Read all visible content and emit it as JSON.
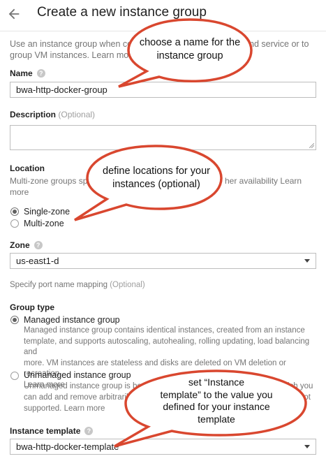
{
  "header": {
    "title": "Create a new instance group",
    "back_icon": "back-arrow-icon"
  },
  "intro": {
    "line1": "Use an instance group when co",
    "line1_tail": "nd service or to",
    "line2": "group VM instances. Learn mor"
  },
  "name": {
    "label": "Name",
    "value": "bwa-http-docker-group"
  },
  "description": {
    "label": "Description",
    "optional": "(Optional)",
    "value": ""
  },
  "location": {
    "label": "Location",
    "help_start": "Multi-zone groups sp",
    "help_tail": "her availability",
    "learn": "Learn",
    "more": "more",
    "options": [
      "Single-zone",
      "Multi-zone"
    ],
    "selected": "Single-zone"
  },
  "zone": {
    "label": "Zone",
    "value": "us-east1-d"
  },
  "port_mapping": {
    "label": "Specify port name mapping",
    "optional": "(Optional)"
  },
  "group_type": {
    "label": "Group type",
    "managed": {
      "label": "Managed instance group",
      "desc": [
        "Managed instance group contains identical instances, created from an instance",
        "template, and supports autoscaling, autohealing, rolling updating, load balancing and",
        "more. VM instances are stateless and disks are deleted on VM deletion or recreation."
      ],
      "learn_more": "Learn more"
    },
    "unmanaged": {
      "label": "Unmanaged instance group",
      "desc1_start": "Unmanaged instance group is be",
      "desc1_end": "ich you",
      "desc2_start": "can add and remove arbitrarily.",
      "desc2_end": "not",
      "desc3_start": "supported.",
      "learn_more": "Learn more"
    },
    "selected": "Managed instance group"
  },
  "instance_template": {
    "label": "Instance template",
    "value": "bwa-http-docker-template"
  },
  "callouts": {
    "name": [
      "choose a name for the",
      "instance group"
    ],
    "location": [
      "define locations for your",
      "instances (optional)"
    ],
    "template": [
      "set “Instance",
      "template” to the value you",
      "defined for your instance",
      "template"
    ]
  },
  "colors": {
    "callout_border": "#d9472f",
    "callout_fill": "#ffffff",
    "text_muted": "#757575"
  }
}
